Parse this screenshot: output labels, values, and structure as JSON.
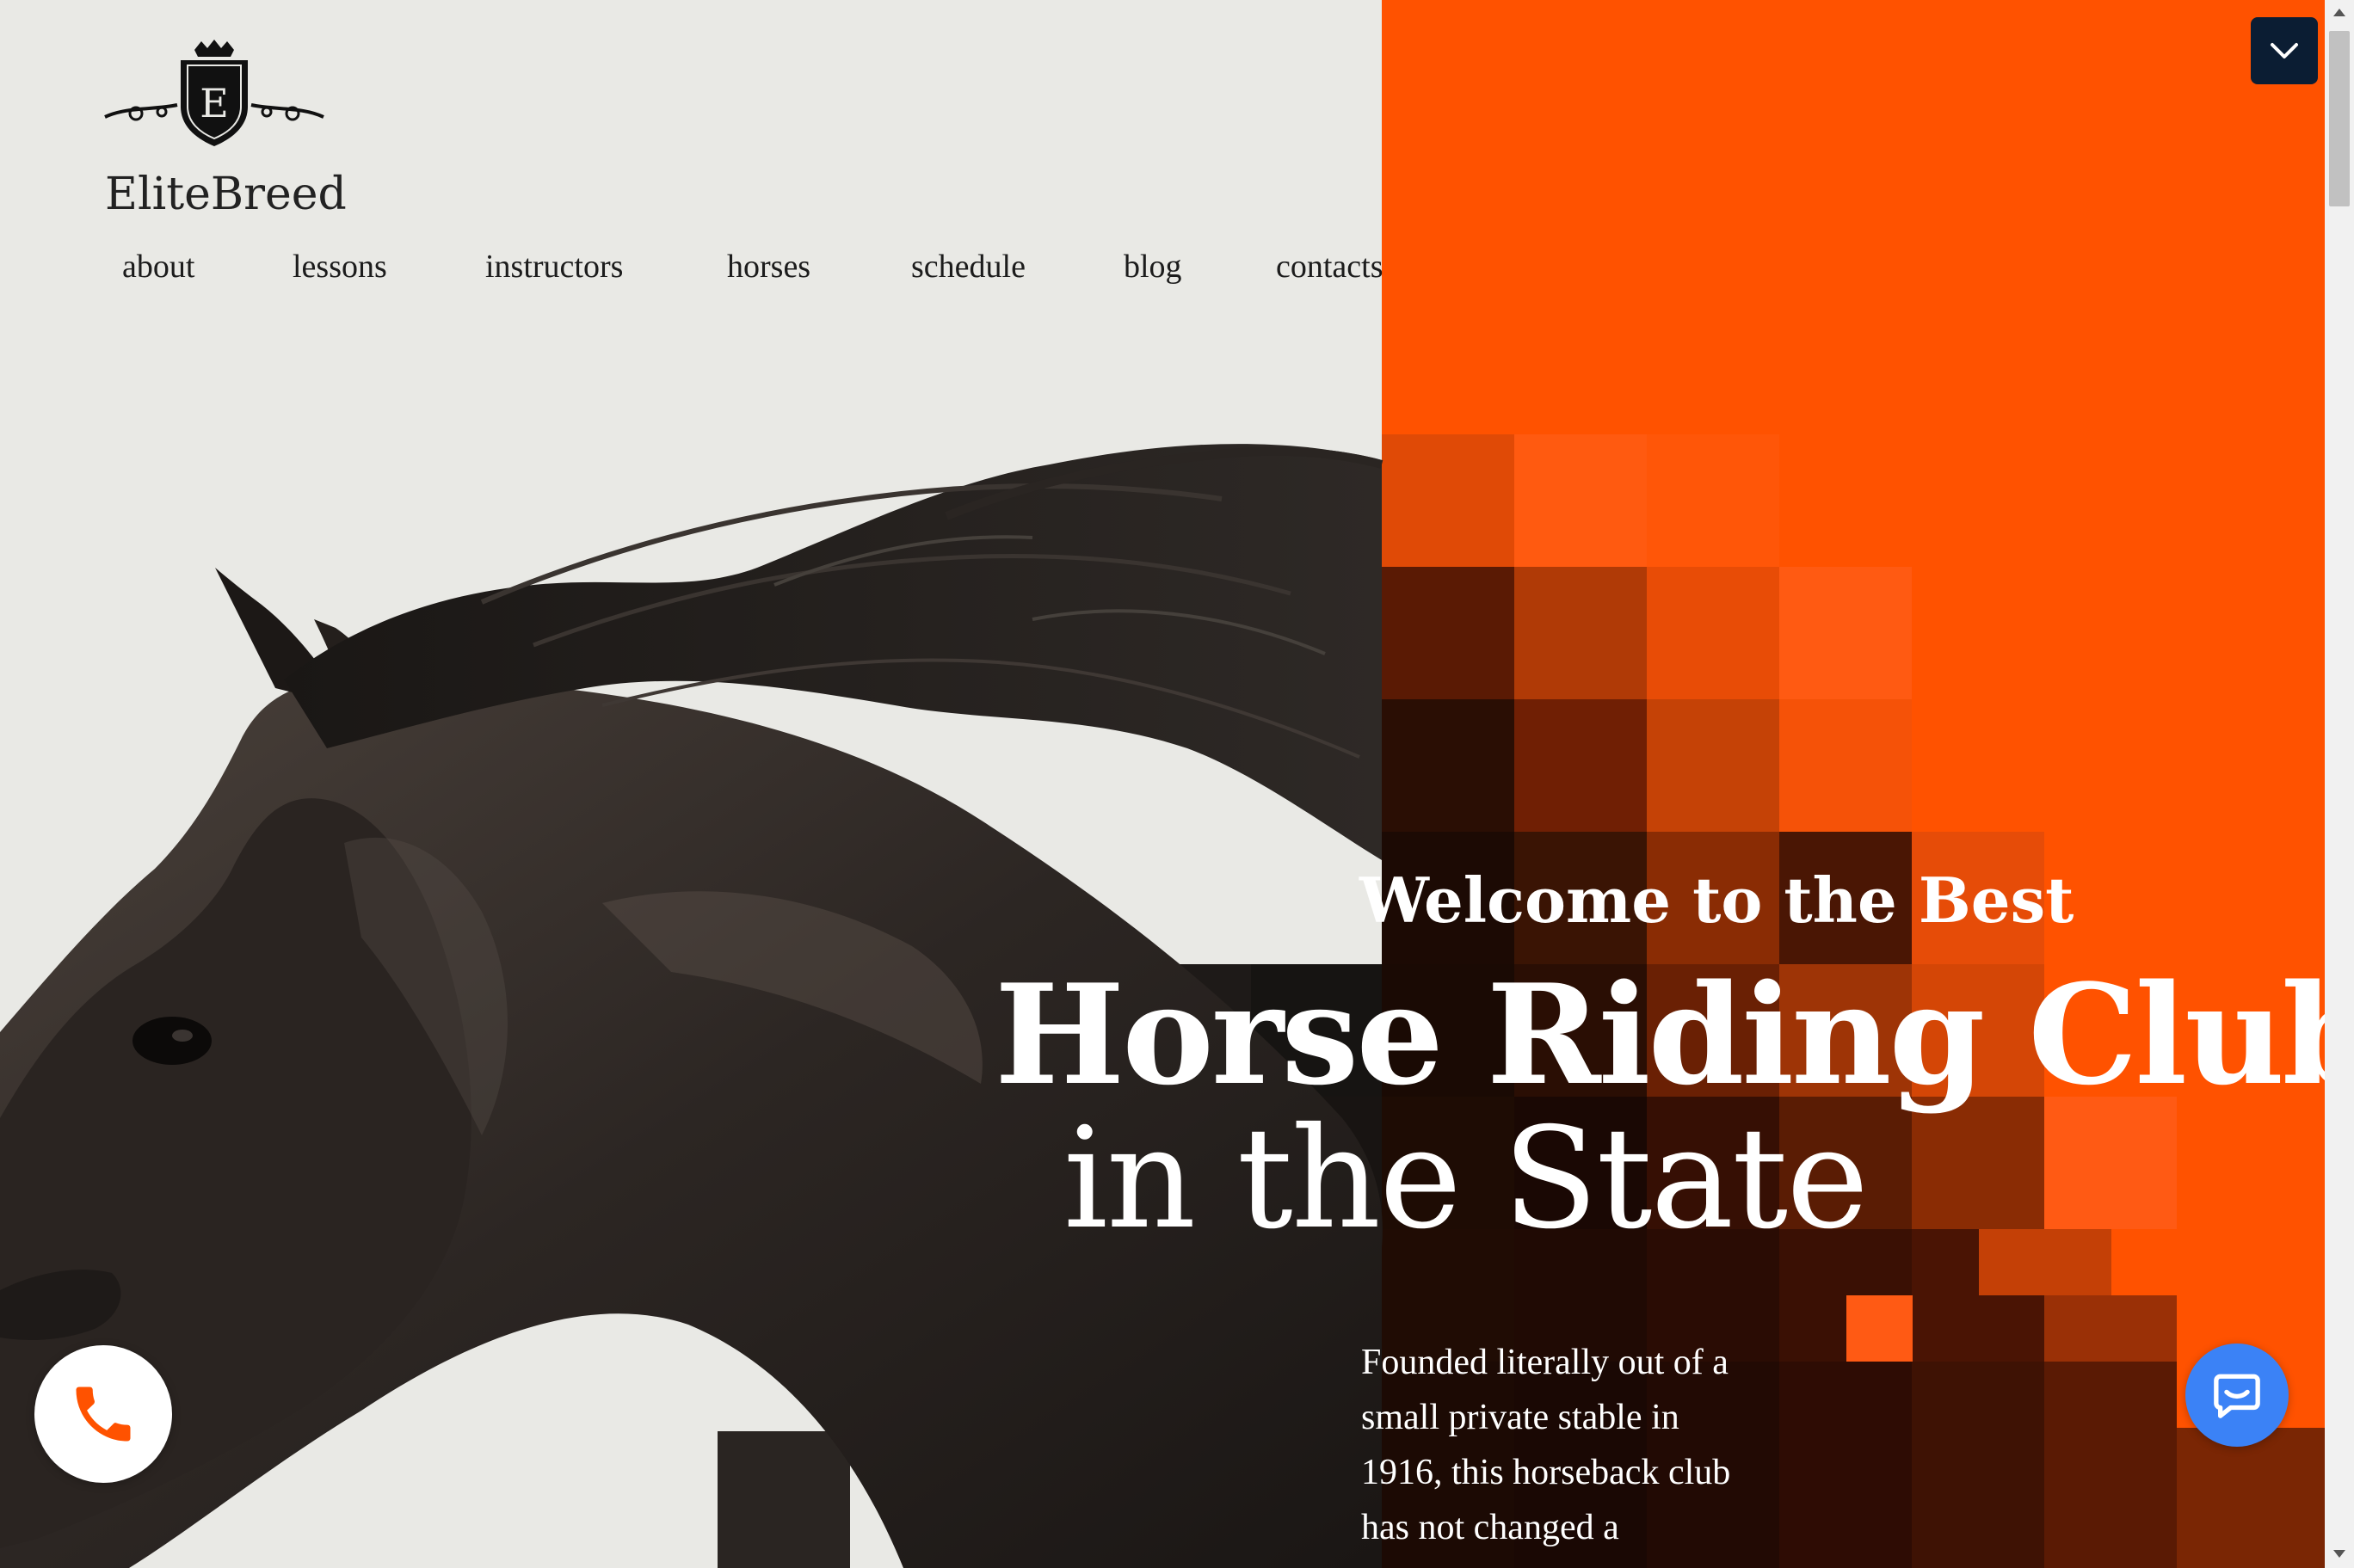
{
  "brand": {
    "monogram": "E",
    "name": "EliteBreed"
  },
  "nav": {
    "items": [
      {
        "label": "about"
      },
      {
        "label": "lessons"
      },
      {
        "label": "instructors"
      },
      {
        "label": "horses"
      },
      {
        "label": "schedule"
      },
      {
        "label": "blog"
      },
      {
        "label": "contacts"
      }
    ]
  },
  "hero": {
    "welcome": "Welcome to the Best",
    "headline_line1": "Horse Riding Club",
    "headline_line2": "in the State",
    "intro": "Founded literally out of a small private stable in 1916, this horseback club has not changed a"
  },
  "widgets": {
    "menu_toggle_icon": "chevron-down-icon",
    "phone_icon": "phone-icon",
    "chat_icon": "chat-bubble-icon"
  },
  "colors": {
    "background": "#e9e9e5",
    "accent_orange": "#ff5200",
    "toggle_navy": "#0b1d33",
    "chat_blue": "#3b82f6"
  }
}
